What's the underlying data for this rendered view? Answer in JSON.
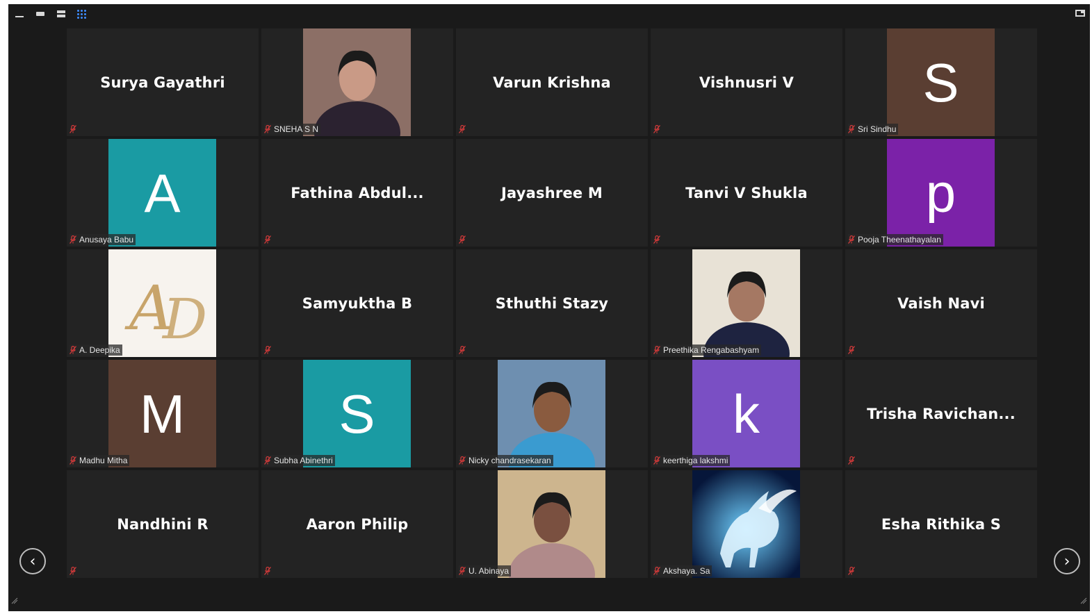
{
  "colors": {
    "app_bg": "#1a1a1a",
    "tile_bg": "#232323",
    "mic_muted": "#d13a3a",
    "grid_active": "#3d8bff"
  },
  "toolbar": {
    "minimize_icon": "minimize-icon",
    "speaker_view_icon": "speaker-view-icon",
    "strip_view_icon": "strip-view-icon",
    "gallery_view_icon": "gallery-view-icon",
    "exit_fullscreen_icon": "exit-fullscreen-icon"
  },
  "participants": [
    {
      "name": "Surya Gayathri",
      "display": "name"
    },
    {
      "name": "SNEHA S N",
      "display": "video",
      "label_bg": true
    },
    {
      "name": "Varun Krishna",
      "display": "name"
    },
    {
      "name": "Vishnusri V",
      "display": "name"
    },
    {
      "name": "Sri Sindhu",
      "display": "avatar",
      "letter": "S",
      "color": "#5a3e32",
      "label_bg": true
    },
    {
      "name": "Anusaya Babu",
      "display": "avatar",
      "letter": "A",
      "color": "#1a9ba3",
      "label_bg": true
    },
    {
      "name": "Fathina  Abdul...",
      "display": "name"
    },
    {
      "name": "Jayashree M",
      "display": "name"
    },
    {
      "name": "Tanvi V Shukla",
      "display": "name"
    },
    {
      "name": "Pooja Theenathayalan",
      "display": "avatar",
      "letter": "p",
      "color": "#7b22a8",
      "label_bg": true
    },
    {
      "name": "A. Deepika",
      "display": "logo",
      "label_bg": true
    },
    {
      "name": "Samyuktha B",
      "display": "name"
    },
    {
      "name": "Sthuthi Stazy",
      "display": "name"
    },
    {
      "name": "Preethika Rengabashyam",
      "display": "video",
      "label_bg": true
    },
    {
      "name": "Vaish Navi",
      "display": "name"
    },
    {
      "name": "Madhu Mitha",
      "display": "avatar",
      "letter": "M",
      "color": "#5a3e32",
      "label_bg": true
    },
    {
      "name": "Subha Abinethri",
      "display": "avatar",
      "letter": "S",
      "color": "#1a9ba3",
      "label_bg": true
    },
    {
      "name": "Nicky chandrasekaran",
      "display": "video",
      "label_bg": true
    },
    {
      "name": "keerthiga lakshmi",
      "display": "avatar",
      "letter": "k",
      "color": "#7a4fc4",
      "label_bg": true
    },
    {
      "name": "Trisha  Ravichan...",
      "display": "name"
    },
    {
      "name": "Nandhini R",
      "display": "name"
    },
    {
      "name": "Aaron Philip",
      "display": "name"
    },
    {
      "name": "U. Abinaya",
      "display": "video",
      "label_bg": true
    },
    {
      "name": "Akshaya. Sa",
      "display": "image",
      "label_bg": true
    },
    {
      "name": "Esha Rithika S",
      "display": "name"
    }
  ],
  "nav": {
    "prev_label": "‹",
    "next_label": "›"
  }
}
